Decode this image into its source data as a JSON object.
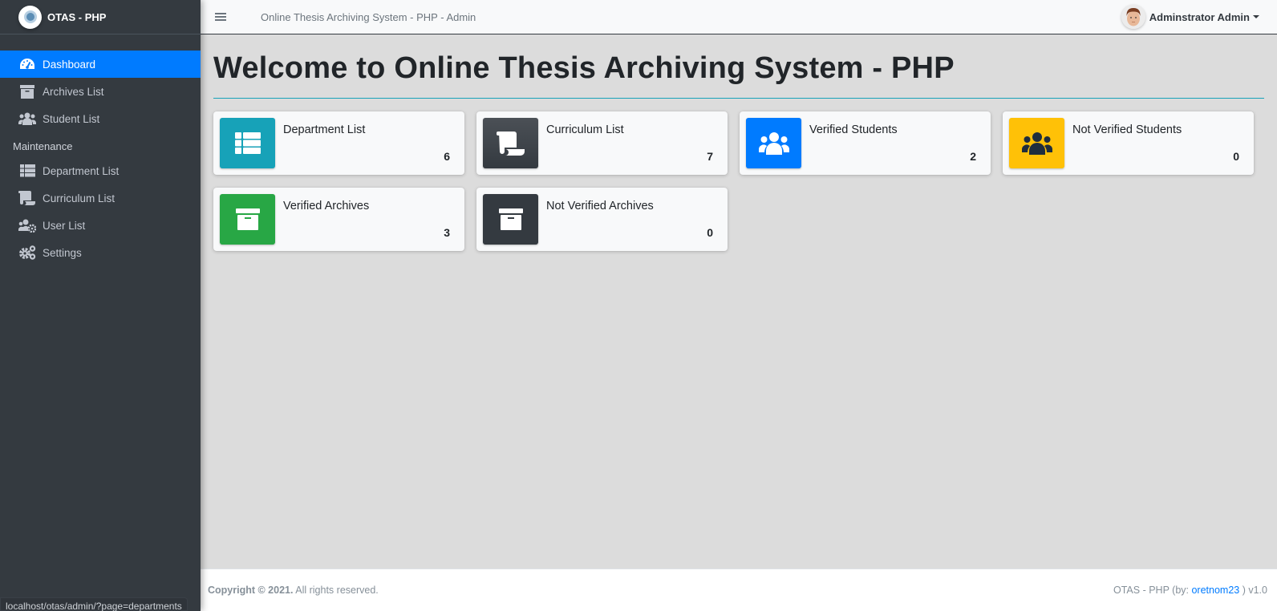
{
  "brand": {
    "name": "OTAS - PHP",
    "logo_icon": "app-logo"
  },
  "sidebar": {
    "items": [
      {
        "label": "Dashboard",
        "icon": "tachometer-icon",
        "active": true
      },
      {
        "label": "Archives List",
        "icon": "archive-icon",
        "active": false
      },
      {
        "label": "Student List",
        "icon": "users-icon",
        "active": false
      }
    ],
    "section_header": "Maintenance",
    "maintenance_items": [
      {
        "label": "Department List",
        "icon": "th-list-icon"
      },
      {
        "label": "Curriculum List",
        "icon": "scroll-icon"
      },
      {
        "label": "User List",
        "icon": "users-cog-icon"
      },
      {
        "label": "Settings",
        "icon": "cogs-icon"
      }
    ]
  },
  "topbar": {
    "title": "Online Thesis Archiving System - PHP - Admin",
    "user_name": "Adminstrator Admin"
  },
  "main": {
    "title": "Welcome to Online Thesis Archiving System - PHP",
    "cards": [
      {
        "label": "Department List",
        "value": "6",
        "icon": "th-list-icon",
        "color": "#17a2b8"
      },
      {
        "label": "Curriculum List",
        "value": "7",
        "icon": "scroll-icon",
        "color": "#343a40"
      },
      {
        "label": "Verified Students",
        "value": "2",
        "icon": "users-icon",
        "color": "#007bff"
      },
      {
        "label": "Not Verified Students",
        "value": "0",
        "icon": "users-icon",
        "color": "#ffc107"
      },
      {
        "label": "Verified Archives",
        "value": "3",
        "icon": "archive-icon",
        "color": "#28a745"
      },
      {
        "label": "Not Verified Archives",
        "value": "0",
        "icon": "archive-icon",
        "color": "#343a40"
      }
    ]
  },
  "footer": {
    "copyright_bold": "Copyright © 2021.",
    "copyright_rest": " All rights reserved.",
    "right_prefix": "OTAS - PHP (by: ",
    "author_link": "oretnom23",
    "right_suffix": " ) v1.0"
  },
  "status_bar": {
    "url": "localhost/otas/admin/?page=departments"
  }
}
